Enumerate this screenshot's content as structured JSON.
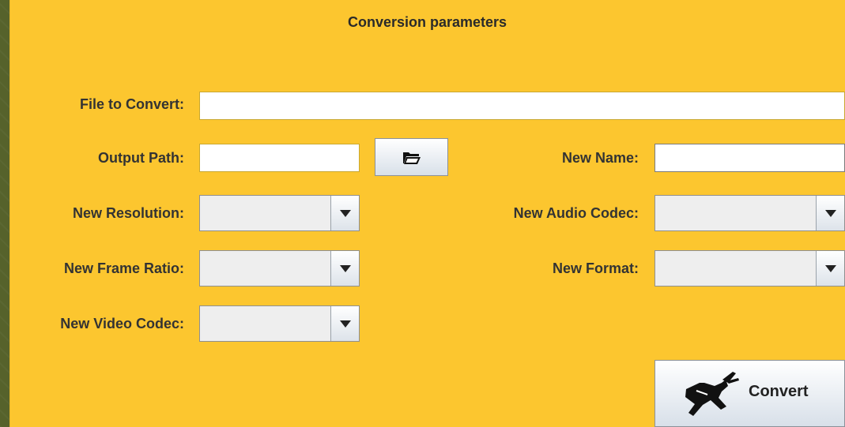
{
  "panel": {
    "title": "Conversion parameters"
  },
  "fields": {
    "file_to_convert": {
      "label": "File to Convert:",
      "value": ""
    },
    "output_path": {
      "label": "Output Path:",
      "value": ""
    },
    "new_name": {
      "label": "New Name:",
      "value": ""
    }
  },
  "combos": {
    "new_resolution": {
      "label": "New Resolution:",
      "value": ""
    },
    "new_frame_ratio": {
      "label": "New Frame Ratio:",
      "value": ""
    },
    "new_video_codec": {
      "label": "New Video Codec:",
      "value": ""
    },
    "new_audio_codec": {
      "label": "New Audio Codec:",
      "value": ""
    },
    "new_format": {
      "label": "New Format:",
      "value": ""
    }
  },
  "buttons": {
    "browse_icon": "folder-open-icon",
    "convert_label": "Convert",
    "convert_icon": "grasshopper-icon"
  },
  "colors": {
    "panel": "#fcc62f",
    "background": "#56622b"
  }
}
